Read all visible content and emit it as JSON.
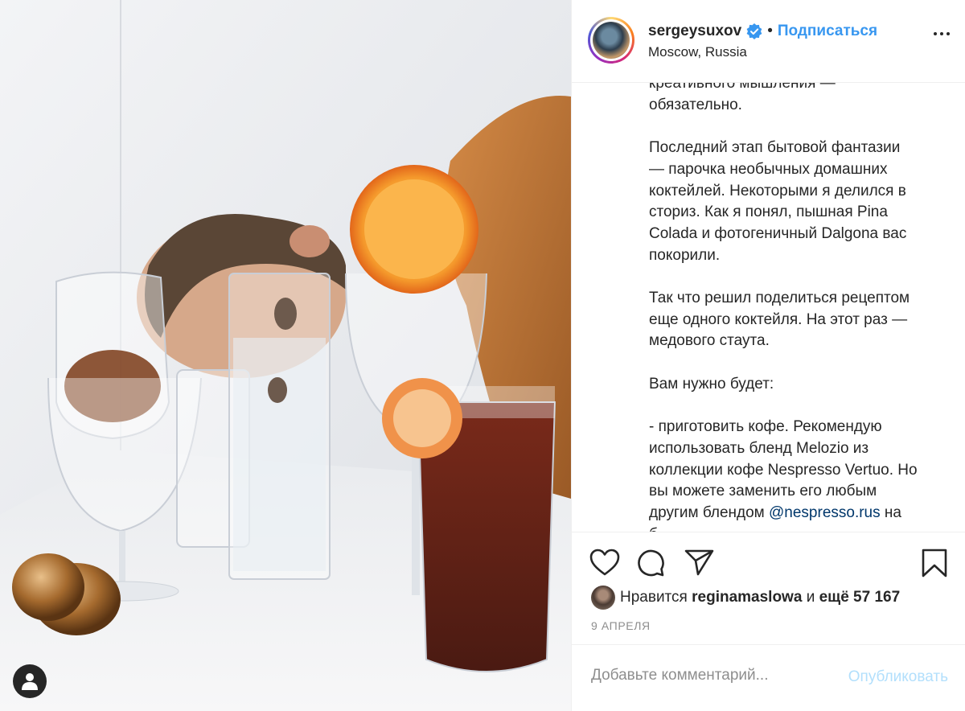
{
  "post": {
    "image_alt": "",
    "user_tag_icon": "user-icon"
  },
  "header": {
    "username": "sergeysuxov",
    "verified_icon": "verified-badge-icon",
    "separator": "•",
    "follow_label": "Подписаться",
    "location": "Moscow, Russia",
    "more_icon": "more-options-icon"
  },
  "caption": {
    "lines_top": "креативного мышления —\nобязательно.\n\nПоследний этап бытовой фантазии\n— парочка необычных домашних\nкоктейлей. Некоторыми я делился в\nсториз. Как я понял, пышная Pina\nColada и фотогеничный Dalgona вас\nпокорили.\n\nТак что решил поделиться рецептом\nеще одного коктейля. На этот раз —\nмедового стаута.\n\nВам нужно будет:\n\n- приготовить кофе. Рекомендую\nиспользовать бленд Melozio из\nколлекции кофе Nespresso Vertuo. Но\nвы можете заменить его любым\nдругим блендом ",
    "mention": "@nespresso.rus",
    "lines_bottom": " на\nб"
  },
  "actions": {
    "like_icon": "heart-icon",
    "comment_icon": "comment-icon",
    "share_icon": "share-icon",
    "save_icon": "bookmark-icon",
    "likes_prefix": "Нравится",
    "liked_by": "reginamaslowa",
    "likes_and": "и",
    "likes_count": "ещё 57 167",
    "date": "9 АПРЕЛЯ"
  },
  "comment": {
    "placeholder": "Добавьте комментарий...",
    "publish_label": "Опубликовать"
  },
  "colors": {
    "accent": "#3897f0",
    "publish_disabled": "#b2dffc",
    "text": "#262626",
    "muted": "#8e8e8e",
    "border": "#efefef"
  }
}
